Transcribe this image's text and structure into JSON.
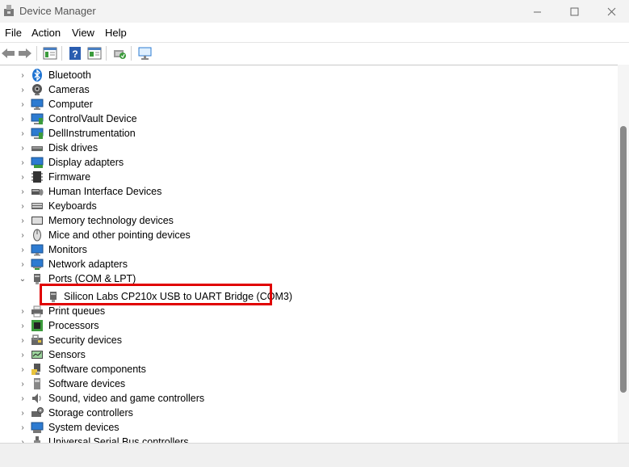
{
  "window": {
    "title": "Device Manager"
  },
  "menu": [
    "File",
    "Action",
    "View",
    "Help"
  ],
  "tree": {
    "items": [
      {
        "label": "Bluetooth",
        "icon": "bluetooth-icon",
        "expanded": false
      },
      {
        "label": "Cameras",
        "icon": "camera-icon",
        "expanded": false
      },
      {
        "label": "Computer",
        "icon": "computer-icon",
        "expanded": false
      },
      {
        "label": "ControlVault Device",
        "icon": "device-icon",
        "expanded": false
      },
      {
        "label": "DellInstrumentation",
        "icon": "device-icon",
        "expanded": false
      },
      {
        "label": "Disk drives",
        "icon": "disk-drive-icon",
        "expanded": false
      },
      {
        "label": "Display adapters",
        "icon": "display-adapter-icon",
        "expanded": false
      },
      {
        "label": "Firmware",
        "icon": "firmware-icon",
        "expanded": false
      },
      {
        "label": "Human Interface Devices",
        "icon": "hid-icon",
        "expanded": false
      },
      {
        "label": "Keyboards",
        "icon": "keyboard-icon",
        "expanded": false
      },
      {
        "label": "Memory technology devices",
        "icon": "memory-icon",
        "expanded": false
      },
      {
        "label": "Mice and other pointing devices",
        "icon": "mouse-icon",
        "expanded": false
      },
      {
        "label": "Monitors",
        "icon": "monitor-icon",
        "expanded": false
      },
      {
        "label": "Network adapters",
        "icon": "network-adapter-icon",
        "expanded": false
      },
      {
        "label": "Ports (COM & LPT)",
        "icon": "port-icon",
        "expanded": true
      },
      {
        "label": "Silicon Labs CP210x USB to UART Bridge (COM3)",
        "icon": "port-device-icon",
        "child": true
      },
      {
        "label": "Print queues",
        "icon": "printer-icon",
        "expanded": false
      },
      {
        "label": "Processors",
        "icon": "processor-icon",
        "expanded": false
      },
      {
        "label": "Security devices",
        "icon": "security-icon",
        "expanded": false
      },
      {
        "label": "Sensors",
        "icon": "sensor-icon",
        "expanded": false
      },
      {
        "label": "Software components",
        "icon": "software-component-icon",
        "expanded": false
      },
      {
        "label": "Software devices",
        "icon": "software-device-icon",
        "expanded": false
      },
      {
        "label": "Sound, video and game controllers",
        "icon": "sound-icon",
        "expanded": false
      },
      {
        "label": "Storage controllers",
        "icon": "storage-icon",
        "expanded": false
      },
      {
        "label": "System devices",
        "icon": "system-icon",
        "expanded": false
      },
      {
        "label": "Universal Serial Bus controllers",
        "icon": "usb-icon",
        "expanded": false
      }
    ]
  },
  "colors": {
    "highlight": "#e00000",
    "accent": "#1e73d2"
  }
}
